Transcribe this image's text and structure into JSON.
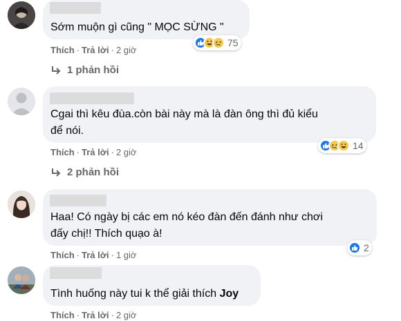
{
  "comments": [
    {
      "text_lines": [
        "Sớm muộn gì cũng \" MỌC SỪNG \""
      ],
      "actions": {
        "like": "Thích",
        "reply": "Trả lời",
        "time": "2 giờ"
      },
      "reactions": {
        "icons": [
          "like-icon",
          "haha-icon",
          "sad-icon"
        ],
        "count": "75"
      },
      "replies": "1 phản hồi"
    },
    {
      "text_lines": [
        "Cgai thì kêu đùa.còn bài này mà là đàn ông thì đủ kiểu",
        "để nói."
      ],
      "actions": {
        "like": "Thích",
        "reply": "Trả lời",
        "time": "2 giờ"
      },
      "reactions": {
        "icons": [
          "like-icon",
          "sad-icon",
          "haha-icon"
        ],
        "count": "14"
      },
      "replies": "2 phản hồi"
    },
    {
      "text_lines": [
        "Haa! Có ngày bị các em nó kéo đàn đến đánh như chơi",
        "đấy chị!! Thích quạo à!"
      ],
      "actions": {
        "like": "Thích",
        "reply": "Trả lời",
        "time": "1 giờ"
      },
      "reactions": {
        "icons": [
          "like-icon"
        ],
        "count": "2"
      }
    },
    {
      "text_lines": [
        "Tình huống này tui k thể giải thích ",
        "Joy"
      ],
      "actions": {
        "like": "Thích",
        "reply": "Trả lời",
        "time": "2 giờ"
      }
    }
  ],
  "colors": {
    "bubble": "#f0f2f5",
    "meta": "#65676b",
    "like": "#1877f2",
    "emoji": "#f7c843"
  }
}
